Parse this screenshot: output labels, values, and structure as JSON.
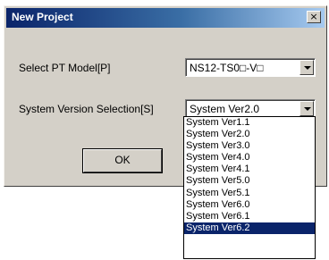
{
  "dialog": {
    "title": "New Project",
    "close_label": "×"
  },
  "model": {
    "label": "Select PT Model[P]",
    "value": "NS12-TS0□-V□"
  },
  "version": {
    "label": "System Version Selection[S]",
    "value": "System Ver2.0",
    "options": [
      "System Ver1.1",
      "System Ver2.0",
      "System Ver3.0",
      "System Ver4.0",
      "System Ver4.1",
      "System Ver5.0",
      "System Ver5.1",
      "System Ver6.0",
      "System Ver6.1",
      "System Ver6.2"
    ],
    "highlighted_option": "System Ver6.2"
  },
  "buttons": {
    "ok_label": "OK"
  },
  "colors": {
    "titlebar_start": "#0a246a",
    "dialog_face": "#d4d0c8",
    "selection": "#0a246a"
  }
}
